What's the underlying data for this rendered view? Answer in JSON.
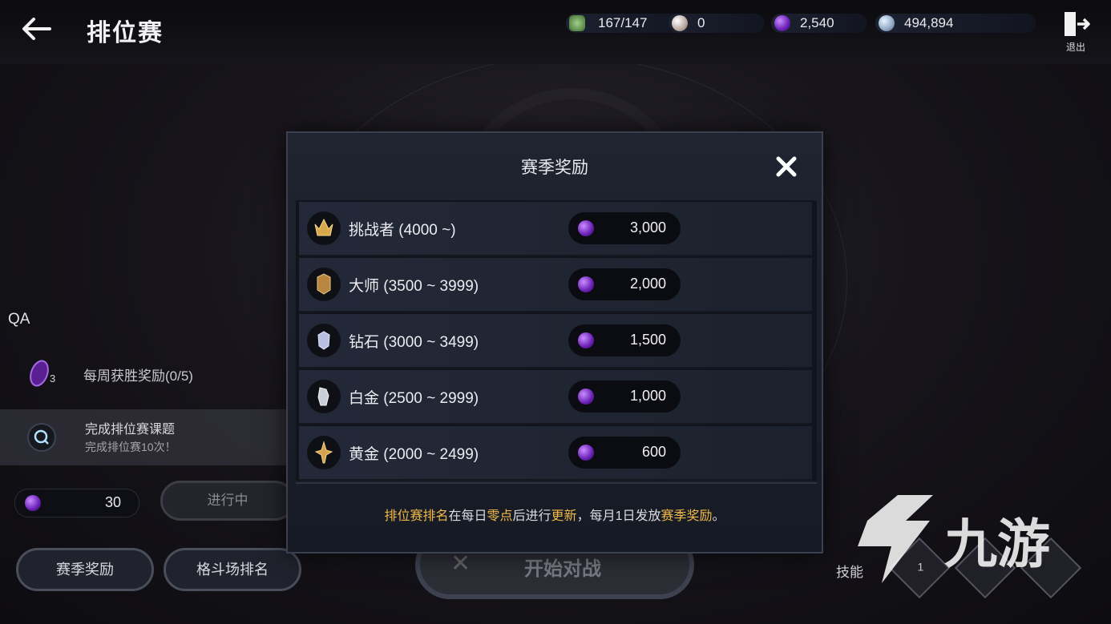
{
  "header": {
    "title": "排位赛",
    "resources": [
      {
        "icon": "stamina-icon",
        "value": "167/147"
      },
      {
        "icon": "pearl-icon",
        "value": "0"
      },
      {
        "icon": "purple-gem-icon",
        "value": "2,540"
      },
      {
        "icon": "silver-coin-icon",
        "value": "494,894"
      }
    ],
    "exit_label": "退出"
  },
  "left_panel": {
    "qa_label": "QA",
    "weekly_reward_label": "每周获胜奖励(0/5)",
    "weekly_item_count": "3",
    "quest_title": "完成排位赛课题",
    "quest_desc": "完成排位赛10次！",
    "quest_reward": "30",
    "status_button": "进行中"
  },
  "bottom": {
    "season_reward_button": "赛季奖励",
    "arena_ranking_button": "格斗场排名",
    "start_battle_label": "开始对战",
    "skill_label": "技能",
    "skill_slot_count": "1"
  },
  "modal": {
    "title": "赛季奖励",
    "rows": [
      {
        "rank": "挑战者 (4000 ~)",
        "amount": "3,000",
        "icon": "challenger-crown-icon"
      },
      {
        "rank": "大师 (3500 ~ 3999)",
        "amount": "2,000",
        "icon": "master-helmet-icon"
      },
      {
        "rank": "钻石 (3000 ~ 3499)",
        "amount": "1,500",
        "icon": "diamond-emblem-icon"
      },
      {
        "rank": "白金 (2500 ~ 2999)",
        "amount": "1,000",
        "icon": "platinum-emblem-icon"
      },
      {
        "rank": "黄金 (2000 ~ 2499)",
        "amount": "600",
        "icon": "gold-emblem-icon"
      }
    ],
    "note": {
      "p1": "排位赛排名",
      "p2": "在每日",
      "p3": "零点",
      "p4": "后进行",
      "p5": "更新",
      "p6": "，每月1日发放",
      "p7": "赛季奖励",
      "p8": "。"
    }
  },
  "watermark": "九游",
  "colors": {
    "highlight": "#f0b94a",
    "gem": "#8a3fe0"
  }
}
